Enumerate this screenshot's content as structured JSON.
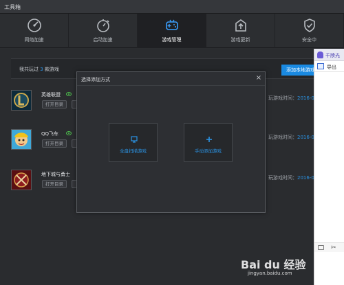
{
  "window": {
    "title": "工具箱"
  },
  "tabs": [
    {
      "label": "网络加速",
      "icon": "speedometer-icon",
      "active": false
    },
    {
      "label": "启动加速",
      "icon": "stopwatch-icon",
      "active": false
    },
    {
      "label": "游戏管理",
      "icon": "gamepad-icon",
      "active": true
    },
    {
      "label": "游戏更新",
      "icon": "update-icon",
      "active": false
    },
    {
      "label": "安全中",
      "icon": "shield-check-icon",
      "active": false
    }
  ],
  "summary": {
    "prefix": "我共玩过",
    "count": "3",
    "suffix": "款游戏",
    "add_button": "添加本地游戏"
  },
  "games": [
    {
      "name": "英雄联盟",
      "open_dir": "打开目录",
      "last_played_label": "玩游戏时间：",
      "last_played_date": "2016-0"
    },
    {
      "name": "QQ飞车",
      "open_dir": "打开目录",
      "last_played_label": "玩游戏时间：",
      "last_played_date": "2016-0"
    },
    {
      "name": "地下城与勇士",
      "open_dir": "打开目录",
      "last_played_label": "玩游戏时间：",
      "last_played_date": "2016-0"
    }
  ],
  "modal": {
    "title": "选择添加方式",
    "close": "×",
    "options": [
      {
        "label": "全盘扫描游戏",
        "icon": "monitor-icon"
      },
      {
        "label": "手动添加游戏",
        "icon": "plus-icon"
      }
    ]
  },
  "side_panel": {
    "title": "千牍光",
    "export_label": "导出"
  },
  "watermark": {
    "main": "Bai du 经验",
    "url": "jingyan.baidu.com"
  },
  "colors": {
    "accent": "#1a8ae2",
    "link": "#2a94e6",
    "eye": "#4ec04e"
  }
}
